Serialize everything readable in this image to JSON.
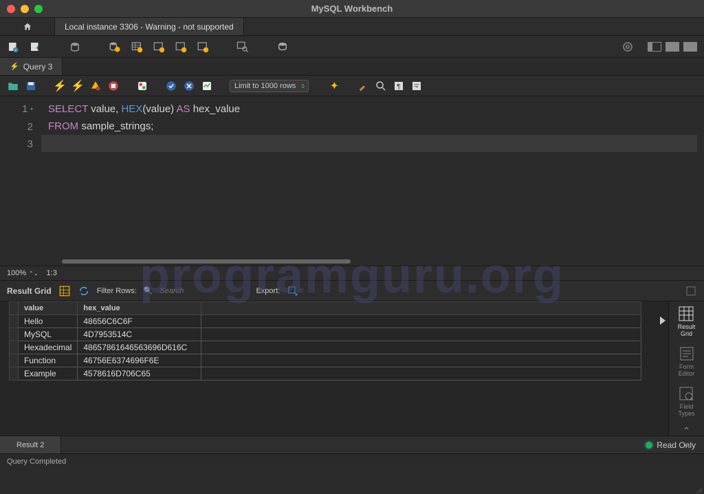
{
  "window": {
    "title": "MySQL Workbench"
  },
  "conn_tab": "Local instance 3306 - Warning - not supported",
  "query_tab": "Query 3",
  "limit_select": "Limit to 1000 rows",
  "editor": {
    "lines": [
      "1",
      "2",
      "3"
    ],
    "line1_kw1": "SELECT",
    "line1_id1": "value",
    "line1_comma": ", ",
    "line1_fn": "HEX",
    "line1_paren": "(value)",
    "line1_kw2": "AS",
    "line1_id2": "hex_value",
    "line2_kw": "FROM",
    "line2_id": "sample_strings;"
  },
  "zoom": "100%",
  "cursor": "1:3",
  "result_label": "Result Grid",
  "filter_label": "Filter Rows:",
  "search_placeholder": "Search",
  "export_label": "Export:",
  "columns": [
    "value",
    "hex_value"
  ],
  "rows": [
    {
      "value": "Hello",
      "hex_value": "48656C6C6F"
    },
    {
      "value": "MySQL",
      "hex_value": "4D7953514C"
    },
    {
      "value": "Hexadecimal",
      "hex_value": "48657861646563696D616C"
    },
    {
      "value": "Function",
      "hex_value": "46756E6374696F6E"
    },
    {
      "value": "Example",
      "hex_value": "4578616D706C65"
    }
  ],
  "side": {
    "grid": "Result\nGrid",
    "form": "Form\nEditor",
    "field": "Field\nTypes"
  },
  "result_tab": "Result 2",
  "readonly": "Read Only",
  "footer": "Query Completed",
  "watermark": "programguru.org"
}
